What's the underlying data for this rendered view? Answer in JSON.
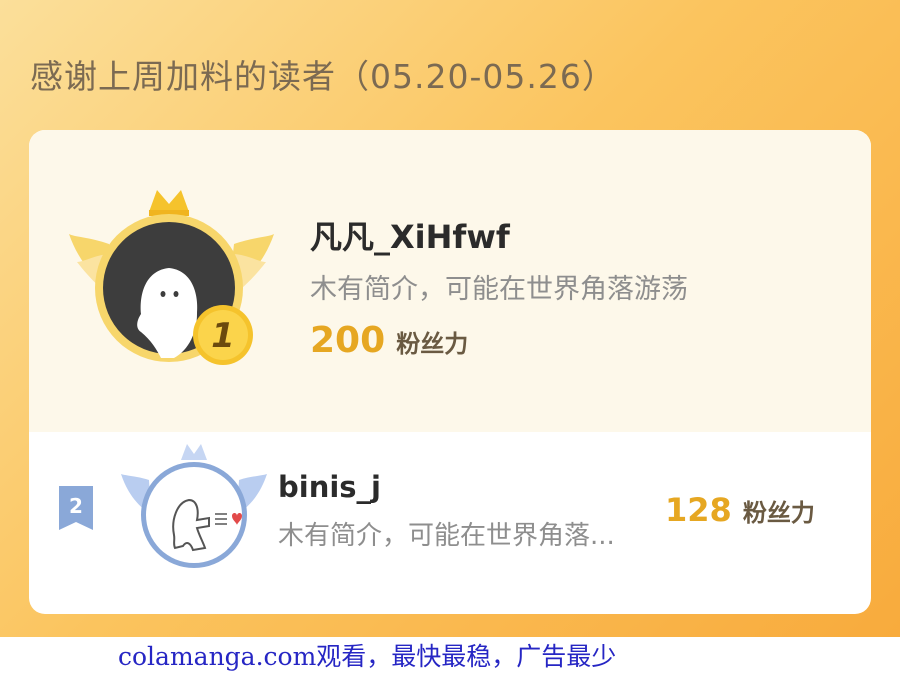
{
  "header": {
    "title": "感谢上周加料的读者（05.20-05.26）"
  },
  "ranking": [
    {
      "rank": "1",
      "name": "凡凡_XiHfwf",
      "bio": "木有简介，可能在世界角落游荡",
      "fans_value": "200",
      "fans_unit": "粉丝力"
    },
    {
      "rank": "2",
      "name": "binis_j",
      "bio": "木有简介，可能在世界角落...",
      "fans_value": "128",
      "fans_unit": "粉丝力"
    }
  ],
  "watermark": {
    "text": "colamanga.com观看，最快最稳，广告最少"
  },
  "icons": {
    "rank1_avatar": "ghost-avatar-icon",
    "rank1_badge": "gold-medal-icon",
    "rank2_avatar": "doodle-avatar-icon",
    "rank2_badge": "rank-ribbon-icon"
  },
  "colors": {
    "accent": "#e6a722",
    "gold": "#f5c32c",
    "silver": "#8aa8d8",
    "text_dark": "#2b2b2b",
    "text_muted": "#8e8e8e"
  }
}
